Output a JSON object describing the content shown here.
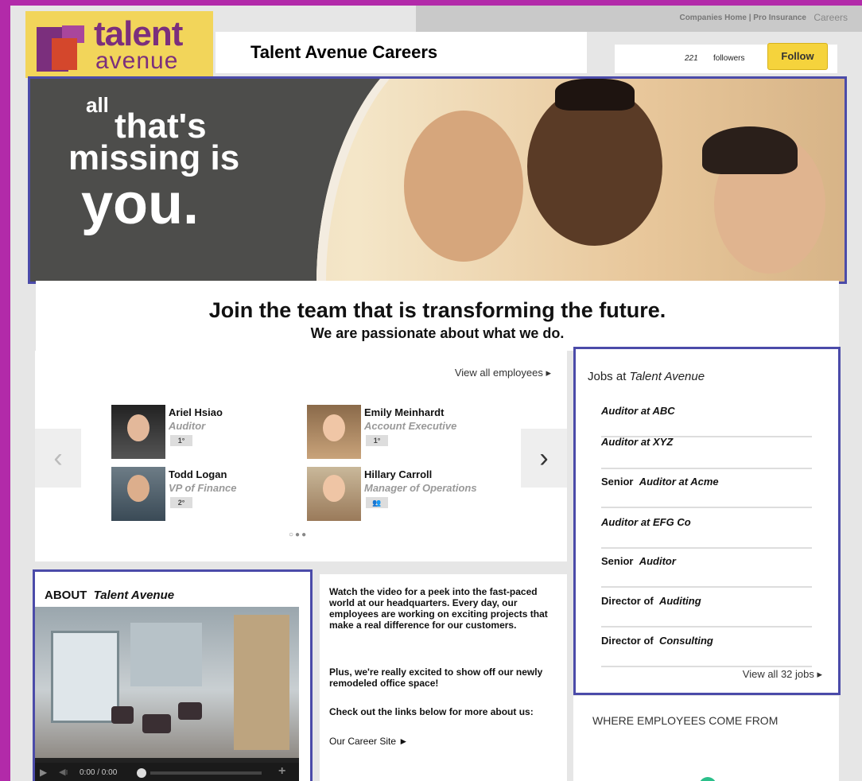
{
  "topnav": {
    "companies_home": "Companies Home",
    "pro_insurance": "Pro Insurance",
    "careers": "Careers"
  },
  "logo": {
    "line1": "talent",
    "line2": "avenue"
  },
  "page_title": "Talent Avenue Careers",
  "follow": {
    "count": "221",
    "label": "followers",
    "button": "Follow"
  },
  "hero": {
    "line1": "all",
    "line2": "that's",
    "line3": "missing is",
    "line4": "you."
  },
  "headline": {
    "main": "Join the team that is transforming the future.",
    "sub": "We are passionate about what we do."
  },
  "employees": {
    "view_all": "View all employees ▸",
    "people": [
      {
        "name": "Ariel Hsiao",
        "role": "Auditor",
        "degree": "1°"
      },
      {
        "name": "Emily Meinhardt",
        "role": "Account Executive",
        "degree": "1°"
      },
      {
        "name": "Todd Logan",
        "role": "VP of Finance",
        "degree": "2°"
      },
      {
        "name": "Hillary Carroll",
        "role": "Manager of Operations",
        "degree": "👥"
      }
    ],
    "prev": "‹",
    "next": "›",
    "pager": "○●●"
  },
  "jobs": {
    "heading_prefix": "Jobs at",
    "heading_company": "Talent Avenue",
    "items": [
      {
        "prefix": "",
        "title": "Auditor at ABC"
      },
      {
        "prefix": "",
        "title": "Auditor at XYZ"
      },
      {
        "prefix": "Senior",
        "title": "Auditor at Acme"
      },
      {
        "prefix": "",
        "title": "Auditor at EFG Co"
      },
      {
        "prefix": "Senior",
        "title": "Auditor"
      },
      {
        "prefix": "Director of",
        "title": "Auditing"
      },
      {
        "prefix": "Director of",
        "title": "Consulting"
      }
    ],
    "view_all": "View all 32 jobs ▸"
  },
  "about": {
    "label": "ABOUT",
    "company": "Talent Avenue",
    "video_time": "0:00 / 0:00",
    "para1": "Watch the video for a peek into the fast-paced world at our headquarters. Every day, our employees are working on exciting projects that make a real difference for our customers.",
    "para2": "Plus, we're really excited to show off our newly remodeled office space!",
    "para3": "Check out the links below for more about us:",
    "link": "Our Career Site ►"
  },
  "where": {
    "heading": "WHERE EMPLOYEES COME FROM"
  }
}
